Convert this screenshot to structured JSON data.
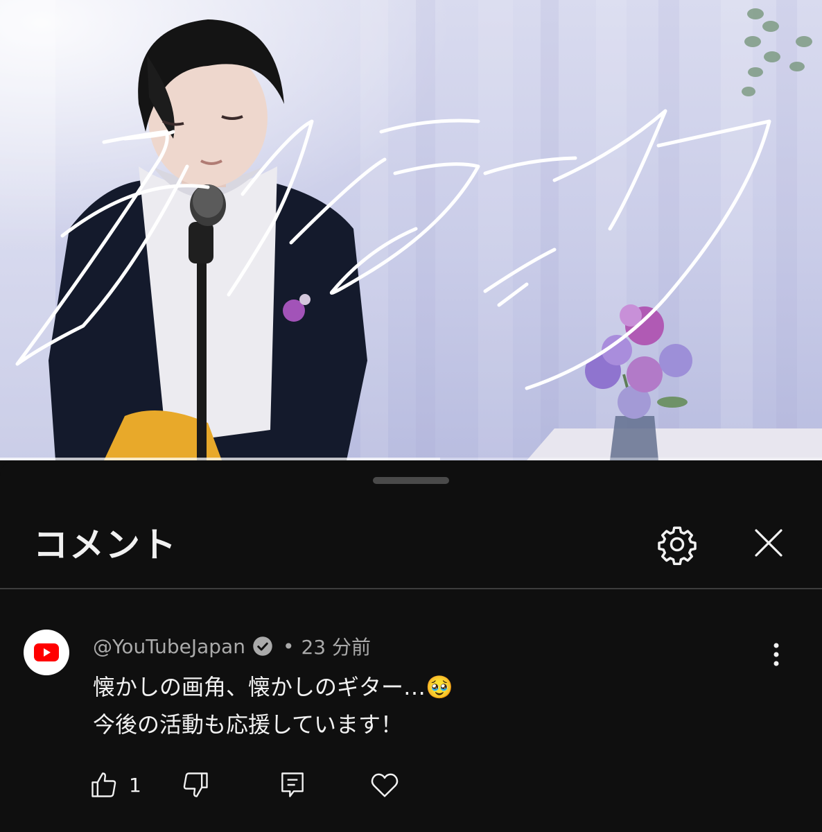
{
  "video": {
    "overlay_title": "ライラック",
    "progress": 0.08,
    "buffered": 0.535
  },
  "comments_panel": {
    "title": "コメント",
    "settings_icon": "gear-icon",
    "close_icon": "close-icon"
  },
  "comment": {
    "author": "@YouTubeJapan",
    "verified": true,
    "separator": "•",
    "time": "23 分前",
    "line1": "懐かしの画角、懐かしのギター…🥹",
    "line2": "今後の活動も応援しています！",
    "like_count": "1",
    "avatar_icon": "youtube-logo-icon",
    "brand_color": "#ff0000"
  },
  "actions": [
    "thumbs-up-icon",
    "thumbs-down-icon",
    "reply-icon",
    "heart-icon"
  ]
}
